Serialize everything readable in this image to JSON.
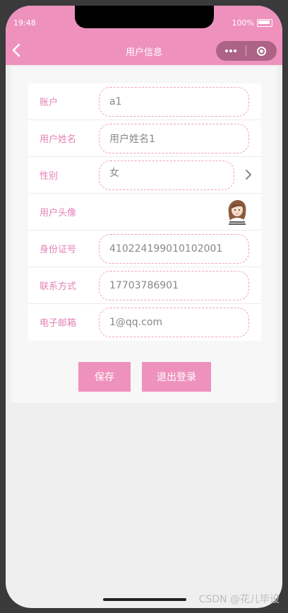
{
  "status": {
    "time": "19:48",
    "battery": "100%"
  },
  "nav": {
    "title": "用户信息"
  },
  "colors": {
    "accent": "#ee92bd",
    "label": "#e581b6",
    "border": "#ee9fc4"
  },
  "form": {
    "account": {
      "label": "账户",
      "value": "a1"
    },
    "username": {
      "label": "用户姓名",
      "value": "用户姓名1"
    },
    "gender": {
      "label": "性别",
      "value": "女"
    },
    "avatar": {
      "label": "用户头像",
      "icon": "avatar-image"
    },
    "idcard": {
      "label": "身份证号",
      "value": "410224199010102001"
    },
    "phone": {
      "label": "联系方式",
      "value": "17703786901"
    },
    "email": {
      "label": "电子邮箱",
      "value": "1@qq.com"
    }
  },
  "actions": {
    "save_label": "保存",
    "logout_label": "退出登录"
  },
  "watermark": "CSDN @花儿毕设"
}
